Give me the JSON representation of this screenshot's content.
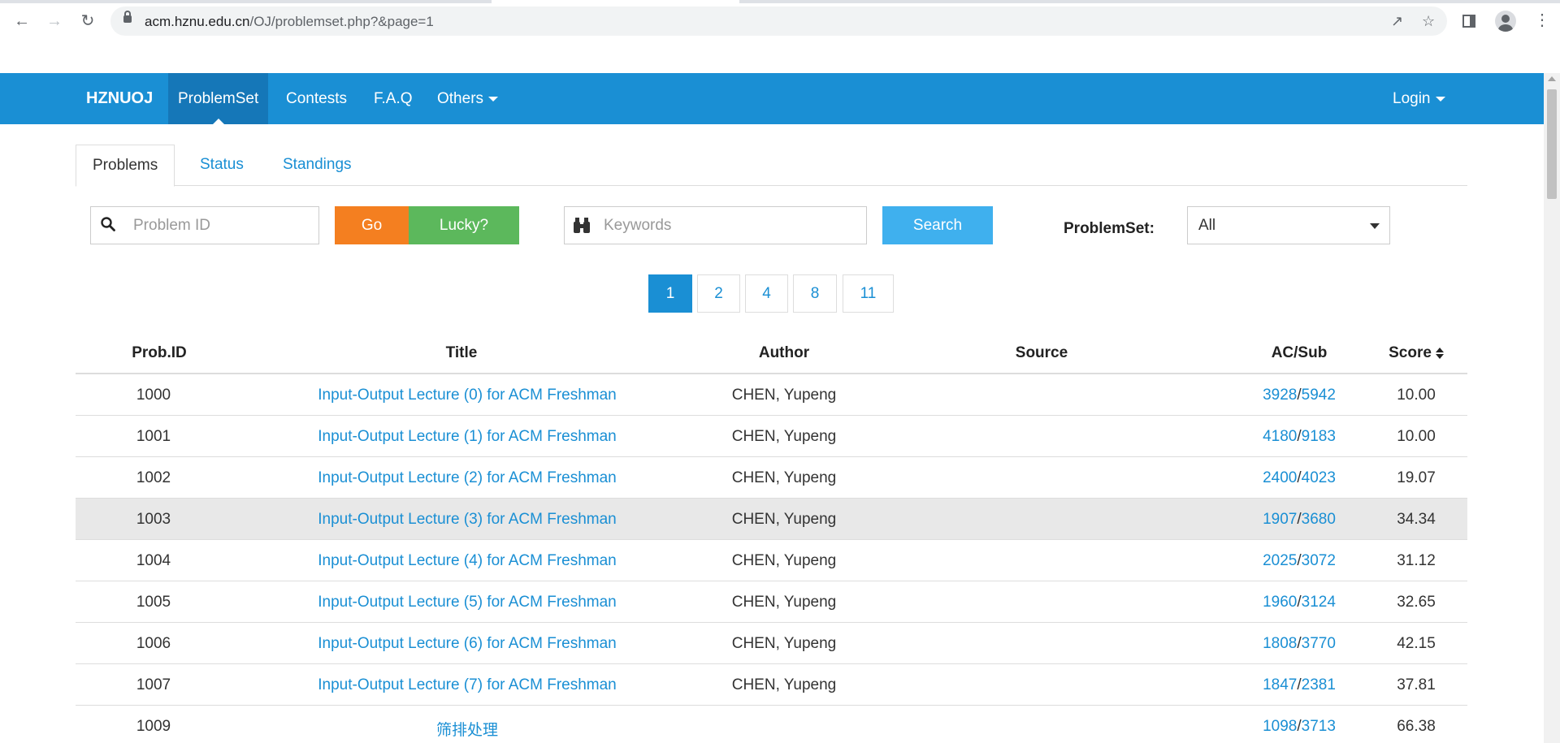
{
  "browser": {
    "url_host": "acm.hznu.edu.cn",
    "url_path": "/OJ/problemset.php?&page=1"
  },
  "navbar": {
    "brand": "HZNUOJ",
    "items": [
      {
        "label": "ProblemSet"
      },
      {
        "label": "Contests"
      },
      {
        "label": "F.A.Q"
      },
      {
        "label": "Others"
      }
    ],
    "login": "Login"
  },
  "tabs": [
    {
      "label": "Problems"
    },
    {
      "label": "Status"
    },
    {
      "label": "Standings"
    }
  ],
  "search": {
    "problem_id_placeholder": "Problem ID",
    "go_label": "Go",
    "lucky_label": "Lucky?",
    "keywords_placeholder": "Keywords",
    "search_label": "Search",
    "problemset_label": "ProblemSet:",
    "problemset_value": "All"
  },
  "pagination": [
    "1",
    "2",
    "4",
    "8",
    "11"
  ],
  "table": {
    "headers": {
      "id": "Prob.ID",
      "title": "Title",
      "author": "Author",
      "source": "Source",
      "acsub": "AC/Sub",
      "score": "Score"
    },
    "rows": [
      {
        "id": "1000",
        "title": "Input-Output Lecture (0) for ACM Freshman",
        "author": "CHEN, Yupeng",
        "source": "",
        "ac": "3928",
        "sub": "5942",
        "score": "10.00"
      },
      {
        "id": "1001",
        "title": "Input-Output Lecture (1) for ACM Freshman",
        "author": "CHEN, Yupeng",
        "source": "",
        "ac": "4180",
        "sub": "9183",
        "score": "10.00"
      },
      {
        "id": "1002",
        "title": "Input-Output Lecture (2) for ACM Freshman",
        "author": "CHEN, Yupeng",
        "source": "",
        "ac": "2400",
        "sub": "4023",
        "score": "19.07"
      },
      {
        "id": "1003",
        "title": "Input-Output Lecture (3) for ACM Freshman",
        "author": "CHEN, Yupeng",
        "source": "",
        "ac": "1907",
        "sub": "3680",
        "score": "34.34"
      },
      {
        "id": "1004",
        "title": "Input-Output Lecture (4) for ACM Freshman",
        "author": "CHEN, Yupeng",
        "source": "",
        "ac": "2025",
        "sub": "3072",
        "score": "31.12"
      },
      {
        "id": "1005",
        "title": "Input-Output Lecture (5) for ACM Freshman",
        "author": "CHEN, Yupeng",
        "source": "",
        "ac": "1960",
        "sub": "3124",
        "score": "32.65"
      },
      {
        "id": "1006",
        "title": "Input-Output Lecture (6) for ACM Freshman",
        "author": "CHEN, Yupeng",
        "source": "",
        "ac": "1808",
        "sub": "3770",
        "score": "42.15"
      },
      {
        "id": "1007",
        "title": "Input-Output Lecture (7) for ACM Freshman",
        "author": "CHEN, Yupeng",
        "source": "",
        "ac": "1847",
        "sub": "2381",
        "score": "37.81"
      },
      {
        "id": "1009",
        "title": "筛排处理",
        "author": "",
        "source": "",
        "ac": "1098",
        "sub": "3713",
        "score": "66.38"
      }
    ]
  },
  "colors": {
    "navbar": "#1a8fd4",
    "navbar_active": "#1577b8",
    "link": "#1a8fd4",
    "go": "#f47f20",
    "lucky": "#5cb85c",
    "search": "#3fb0ee",
    "row_hover": "#e8e8e8"
  }
}
